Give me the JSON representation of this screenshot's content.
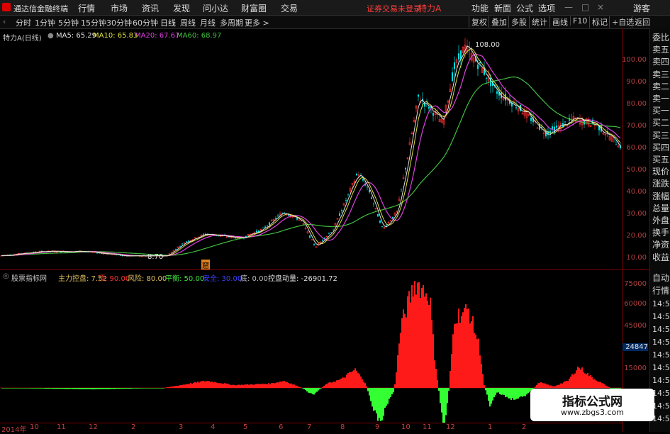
{
  "menubar": {
    "app_name": "通达信金融终端",
    "items": [
      "行情",
      "市场",
      "资讯",
      "发现",
      "问小达",
      "财富圈",
      "交易"
    ],
    "login_notice": "证券交易未登录",
    "stock_name": "特力A",
    "right_items": [
      "功能",
      "新面",
      "公式",
      "选项"
    ],
    "guest": "游客"
  },
  "toolbar": {
    "periods": [
      "分时",
      "1分钟",
      "5分钟",
      "15分钟",
      "30分钟",
      "60分钟",
      "日线",
      "周线",
      "月线",
      "多周期",
      "更多 >"
    ],
    "active_period": "日线",
    "right_buttons": [
      "复权",
      "叠加",
      "多股",
      "统计",
      "画线",
      "F10",
      "标记",
      "+自选",
      "返回"
    ]
  },
  "main_legend": {
    "title": "特力A(日线)",
    "ma5": "MA5: 65.29",
    "ma10": "MA10: 65.83",
    "ma20": "MA20: 67.67",
    "ma60": "MA60: 68.97",
    "high_label": "108.00",
    "low_label": "8.70",
    "signal_tag": "窟"
  },
  "price_axis": [
    "100.00",
    "90.00",
    "80.00",
    "70.00",
    "60.00",
    "50.00",
    "40.00",
    "30.00",
    "20.00",
    "10.00"
  ],
  "indicator_legend": {
    "name": "股票指标网",
    "items": [
      {
        "label": "主力控盘: 7.52",
        "color": "#e0c060"
      },
      {
        "label": "顶: 90.00",
        "color": "#ff3030"
      },
      {
        "label": "风险: 80.00",
        "color": "#e0c060"
      },
      {
        "label": "平衡: 50.00",
        "color": "#40e040"
      },
      {
        "label": "安全: 30.00",
        "color": "#4040ff"
      },
      {
        "label": "底: 0.00",
        "color": "#c0c0c0"
      },
      {
        "label": "控盘动量: -26901.72",
        "color": "#e0e0e0"
      }
    ]
  },
  "indicator_axis": [
    "75000",
    "60000",
    "45000",
    "30000",
    "15000"
  ],
  "indicator_current": "24847",
  "side_panel": [
    "委比",
    "卖五",
    "卖四",
    "卖三",
    "卖二",
    "卖一",
    "买一",
    "买二",
    "买三",
    "买四",
    "买五",
    "现价",
    "涨跌",
    "涨幅",
    "总量",
    "外盘",
    "换手",
    "净资",
    "收益"
  ],
  "side_panel_bottom": [
    "自动",
    "行情",
    "14:50",
    "14:50",
    "14:50",
    "14:50",
    "14:50",
    "14:50",
    "14:50",
    "14:50",
    "14:50",
    "14:50"
  ],
  "date_axis": [
    "2014年",
    "10",
    "11",
    "12",
    "2",
    "3",
    "4",
    "5",
    "6",
    "7",
    "8",
    "9",
    "10",
    "11",
    "12",
    "1",
    "2"
  ],
  "watermark": {
    "title": "指标公式网",
    "url": "www.zbgs3.com"
  },
  "colors": {
    "up": "#ff3030",
    "down": "#00e0e0",
    "ma5": "#e0e0e0",
    "ma10": "#e0e040",
    "ma20": "#e040e0",
    "ma60": "#40c040",
    "bar_pos": "#ff1a1a",
    "bar_neg": "#33ff33"
  }
}
